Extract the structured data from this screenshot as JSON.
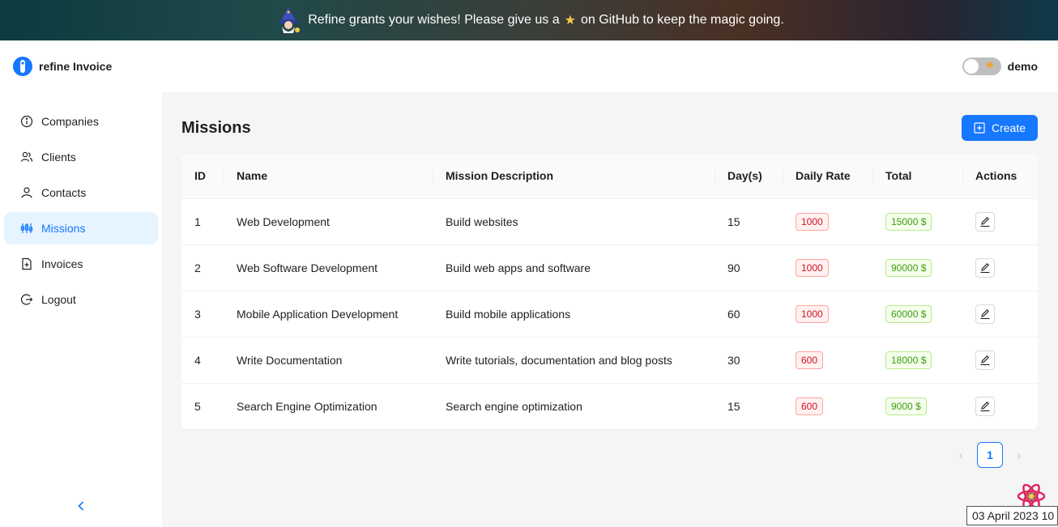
{
  "banner": {
    "text_before": "Refine grants your wishes! Please give us a",
    "text_after": "on GitHub to keep the magic going."
  },
  "header": {
    "brand": "refine Invoice",
    "user": "demo"
  },
  "sidebar": {
    "items": [
      {
        "label": "Companies",
        "icon": "info-circle-icon"
      },
      {
        "label": "Clients",
        "icon": "team-icon"
      },
      {
        "label": "Contacts",
        "icon": "user-icon"
      },
      {
        "label": "Missions",
        "icon": "sliders-icon",
        "active": true
      },
      {
        "label": "Invoices",
        "icon": "file-add-icon"
      },
      {
        "label": "Logout",
        "icon": "logout-icon"
      }
    ]
  },
  "page": {
    "title": "Missions",
    "create_label": "Create"
  },
  "table": {
    "columns": [
      "ID",
      "Name",
      "Mission Description",
      "Day(s)",
      "Daily Rate",
      "Total",
      "Actions"
    ],
    "rows": [
      {
        "id": "1",
        "name": "Web Development",
        "description": "Build websites",
        "days": "15",
        "rate": "1000",
        "total": "15000 $"
      },
      {
        "id": "2",
        "name": "Web Software Development",
        "description": "Build web apps and software",
        "days": "90",
        "rate": "1000",
        "total": "90000 $"
      },
      {
        "id": "3",
        "name": "Mobile Application Development",
        "description": "Build mobile applications",
        "days": "60",
        "rate": "1000",
        "total": "60000 $"
      },
      {
        "id": "4",
        "name": "Write Documentation",
        "description": "Write tutorials, documentation and blog posts",
        "days": "30",
        "rate": "600",
        "total": "18000 $"
      },
      {
        "id": "5",
        "name": "Search Engine Optimization",
        "description": "Search engine optimization",
        "days": "15",
        "rate": "600",
        "total": "9000 $"
      }
    ]
  },
  "pagination": {
    "current": "1"
  },
  "timestamp": "03 April 2023 10",
  "colors": {
    "primary": "#1677ff",
    "tag_red": "#cf1322",
    "tag_green": "#389e0d"
  }
}
